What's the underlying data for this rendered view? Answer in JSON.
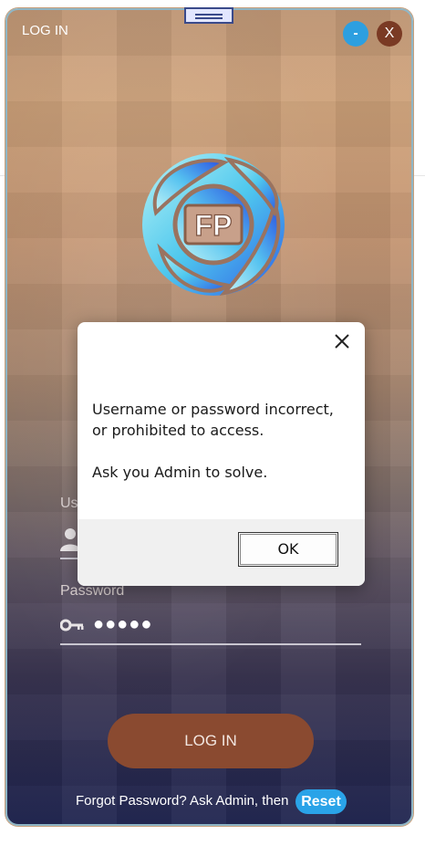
{
  "window": {
    "title": "LOG IN",
    "minimize_label": "-",
    "close_label": "X"
  },
  "logo": {
    "text": "FP"
  },
  "form": {
    "username_label": "Us",
    "password_label": "Password",
    "password_value": "●●●●●",
    "login_button": "LOG IN"
  },
  "footer": {
    "text": "Forgot Password? Ask Admin, then",
    "reset_button": "Reset"
  },
  "dialog": {
    "line1": "Username or password incorrect,",
    "line2": "or prohibited to access.",
    "line3": "Ask you Admin to solve.",
    "ok_button": "OK"
  },
  "colors": {
    "accent_blue": "#2d9fe0",
    "close_brown": "#7a3a24",
    "login_button": "#8a4a30",
    "reset_button": "#2aa3e8"
  }
}
